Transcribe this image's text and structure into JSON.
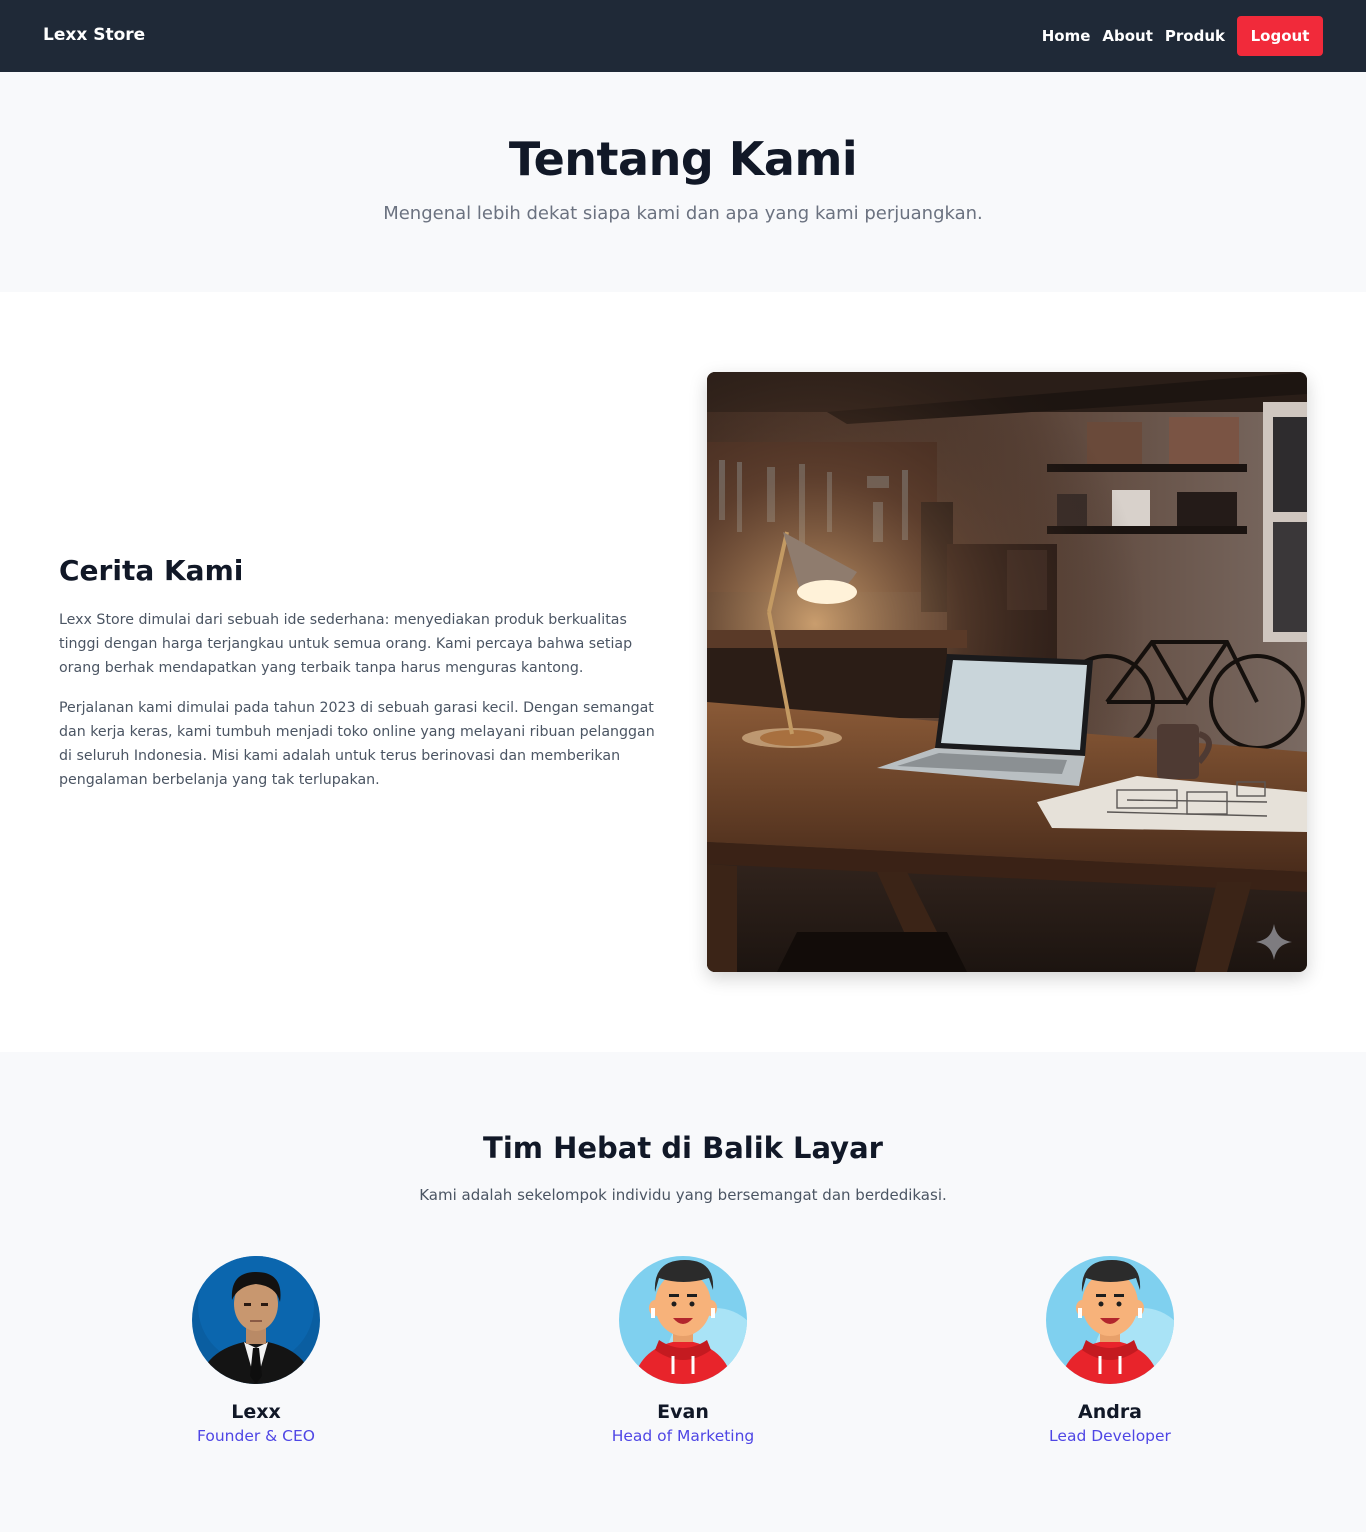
{
  "navbar": {
    "brand": "Lexx Store",
    "links": [
      "Home",
      "About",
      "Produk"
    ],
    "logout": "Logout",
    "logout_color": "#f12a3a",
    "background": "#1f2937"
  },
  "hero": {
    "title": "Tentang Kami",
    "subtitle": "Mengenal lebih dekat siapa kami dan apa yang kami perjuangkan."
  },
  "story": {
    "title": "Cerita Kami",
    "paragraphs": [
      "Lexx Store dimulai dari sebuah ide sederhana: menyediakan produk berkualitas tinggi dengan harga terjangkau untuk semua orang. Kami percaya bahwa setiap orang berhak mendapatkan yang terbaik tanpa harus menguras kantong.",
      "Perjalanan kami dimulai pada tahun 2023 di sebuah garasi kecil. Dengan semangat dan kerja keras, kami tumbuh menjadi toko online yang melayani ribuan pelanggan di seluruh Indonesia. Misi kami adalah untuk terus berinovasi dan memberikan pengalaman berbelanja yang tak terlupakan."
    ],
    "image_icon": "sparkle-icon"
  },
  "team": {
    "title": "Tim Hebat di Balik Layar",
    "subtitle": "Kami adalah sekelompok individu yang bersemangat dan berdedikasi.",
    "role_color": "#4f46e5",
    "members": [
      {
        "name": "Lexx",
        "role": "Founder & CEO"
      },
      {
        "name": "Evan",
        "role": "Head of Marketing"
      },
      {
        "name": "Andra",
        "role": "Lead Developer"
      }
    ]
  }
}
